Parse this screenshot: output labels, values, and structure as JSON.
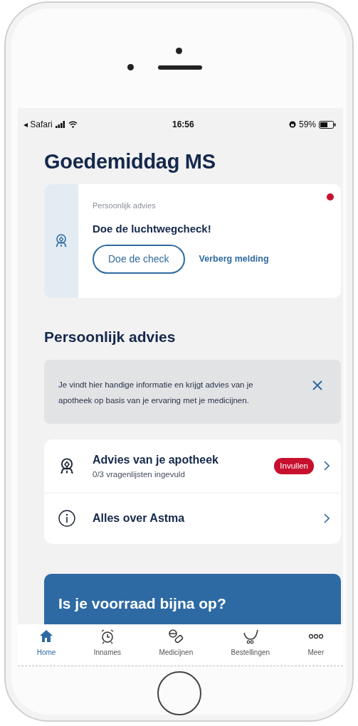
{
  "status_bar": {
    "back_label": "◂ Safari",
    "time": "16:56",
    "battery_text": "59%",
    "battery": {
      "level": 0.59
    }
  },
  "greeting": "Goedemiddag MS",
  "notification": {
    "category": "Persoonlijk advies",
    "title": "Doe de luchtwegcheck!",
    "primary_action": "Doe de check",
    "secondary_action": "Verberg melding",
    "unread": true
  },
  "section_title": "Persoonlijk advies",
  "info_box": {
    "text": "Je vindt hier handige informatie en krijgt advies van je apotheek op basis van je ervaring met je medicijnen.",
    "closable": true
  },
  "advice_items": [
    {
      "kind": "advisor",
      "title": "Advies van je apotheek",
      "subtitle": "0/3 vragenlijsten ingevuld",
      "badge": "Invullen",
      "color": "#c8102e"
    },
    {
      "kind": "info",
      "title": "Alles over Astma"
    }
  ],
  "promo": {
    "title": "Is je voorraad bijna op?"
  },
  "tabs": [
    {
      "label": "Home",
      "selected": true
    },
    {
      "label": "Innames",
      "selected": false
    },
    {
      "label": "Medicijnen",
      "selected": false
    },
    {
      "label": "Bestellingen",
      "selected": false
    },
    {
      "label": "Meer",
      "selected": false
    }
  ]
}
